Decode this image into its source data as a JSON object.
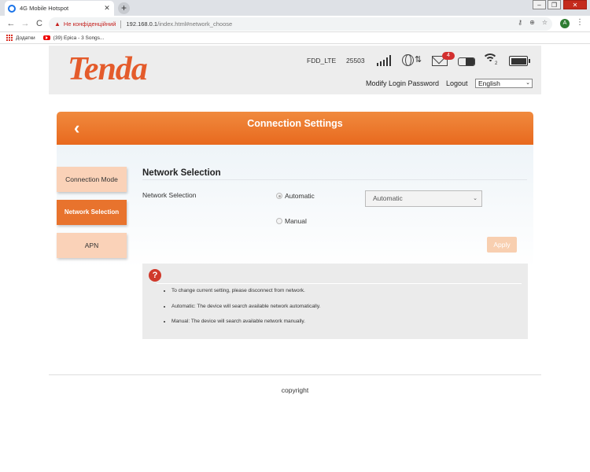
{
  "browser": {
    "tab_title": "4G Mobile Hotspot",
    "tab_close": "✕",
    "new_tab": "+",
    "window_controls": [
      "–",
      "❐",
      "✕"
    ],
    "nav": {
      "back": "←",
      "forward": "→",
      "reload": "C"
    },
    "address": {
      "warning_icon": "▲",
      "insecure_label": "Не конфіденційний",
      "host": "192.168.0.1",
      "path": "/index.html#network_choose"
    },
    "omni_icons": [
      "⚷",
      "⊕",
      "☆"
    ],
    "profile_initial": "A",
    "menu": "⋮",
    "bookmarks": {
      "apps_label": "Додатки",
      "item1": "(39) Epica - 3 Songs..."
    }
  },
  "header": {
    "logo": "Tenda",
    "network_type": "FDD_LTE",
    "network_code": "25503",
    "signal_level": 5,
    "sms_count": "4",
    "wifi_clients": "2",
    "modify_password": "Modify Login Password",
    "logout": "Logout",
    "language": "English"
  },
  "page": {
    "title": "Connection Settings",
    "back_glyph": "‹"
  },
  "sidebar": {
    "items": [
      {
        "label": "Connection Mode",
        "active": false
      },
      {
        "label": "Network Selection",
        "active": true
      },
      {
        "label": "APN",
        "active": false
      }
    ]
  },
  "form": {
    "section_title": "Network Selection",
    "field_label": "Network Selection",
    "radio_automatic": "Automatic",
    "radio_manual": "Manual",
    "selected_mode": "Automatic",
    "select_value": "Automatic",
    "apply_label": "Apply"
  },
  "help": {
    "icon": "?",
    "items": [
      "To change current setting, please disconnect from network.",
      "Automatic: The device will search available network automatically.",
      "Manual: The device will search available network manually."
    ]
  },
  "footer": {
    "copyright": "copyright"
  },
  "colors": {
    "brand": "#e45b2b",
    "accent": "#e8732d",
    "accent_light": "#fad2b8",
    "danger": "#d0392b"
  }
}
